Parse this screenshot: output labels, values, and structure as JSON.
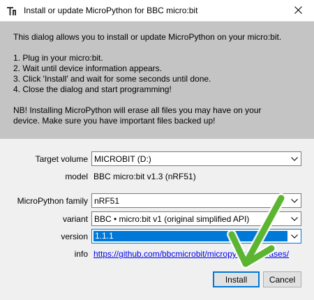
{
  "window": {
    "title": "Install or update MicroPython for BBC micro:bit",
    "close_glyph": "✕"
  },
  "info": {
    "intro": "This dialog allows you to install or update MicroPython on your micro:bit.",
    "step1": "1. Plug in your micro:bit.",
    "step2": "2. Wait until device information appears.",
    "step3": "3. Click 'Install' and wait for some seconds until done.",
    "step4": "4. Close the dialog and start programming!",
    "warning_line1": "NB! Installing MicroPython will erase all files you may have on your",
    "warning_line2": "device. Make sure you have important files backed up!"
  },
  "form": {
    "target_volume_label": "Target volume",
    "target_volume_value": "MICROBIT (D:)",
    "model_label": "model",
    "model_value": "BBC micro:bit v1.3   (nRF51)",
    "family_label": "MicroPython family",
    "family_value": "nRF51",
    "variant_label": "variant",
    "variant_value": "BBC • micro:bit v1 (original simplified API)",
    "version_label": "version",
    "version_value": "1.1.1",
    "info_label": "info",
    "info_link": "https://github.com/bbcmicrobit/micropython/releases/"
  },
  "buttons": {
    "install": "Install",
    "cancel": "Cancel"
  },
  "colors": {
    "info_panel_bg": "#c4c4c4",
    "form_bg": "#f0f0f0",
    "selection": "#0078d7",
    "annotation_arrow": "#5cb531"
  }
}
